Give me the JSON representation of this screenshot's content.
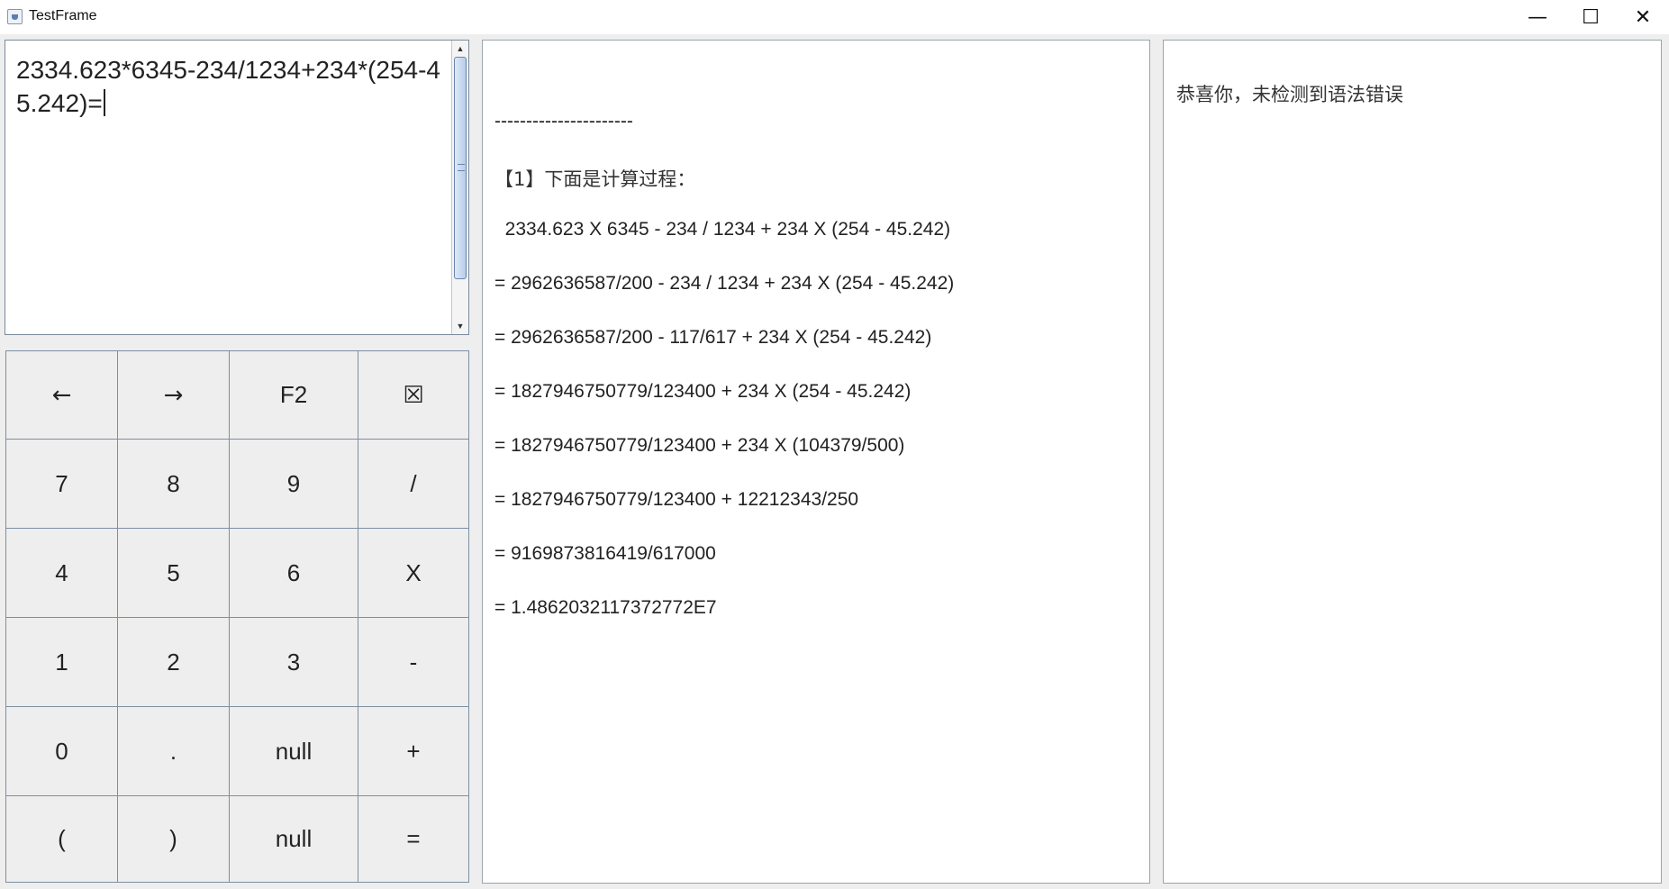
{
  "window": {
    "title": "TestFrame",
    "min_glyph": "—",
    "max_glyph": "☐",
    "close_glyph": "✕"
  },
  "input": {
    "expression": "2334.623*6345-234/1234+234*(254-45.242)="
  },
  "keypad": {
    "rows": [
      [
        "←",
        "→",
        "F2",
        "☒"
      ],
      [
        "7",
        "8",
        "9",
        "/"
      ],
      [
        "4",
        "5",
        "6",
        "X"
      ],
      [
        "1",
        "2",
        "3",
        "-"
      ],
      [
        "0",
        ".",
        "null",
        "+"
      ],
      [
        "(",
        ")",
        "null",
        "="
      ]
    ]
  },
  "process": {
    "separator": "----------------------",
    "heading": "【1】下面是计算过程：",
    "steps": [
      "  2334.623 X 6345 - 234 / 1234 + 234 X (254 - 45.242)",
      "= 2962636587/200 - 234 / 1234 + 234 X (254 - 45.242)",
      "= 2962636587/200 - 117/617 + 234 X (254 - 45.242)",
      "= 1827946750779/123400 + 234 X (254 - 45.242)",
      "= 1827946750779/123400 + 234 X (104379/500)",
      "= 1827946750779/123400 + 12212343/250",
      "= 9169873816419/617000",
      "= 1.4862032117372772E7"
    ]
  },
  "result": {
    "message": "恭喜你，未检测到语法错误"
  }
}
